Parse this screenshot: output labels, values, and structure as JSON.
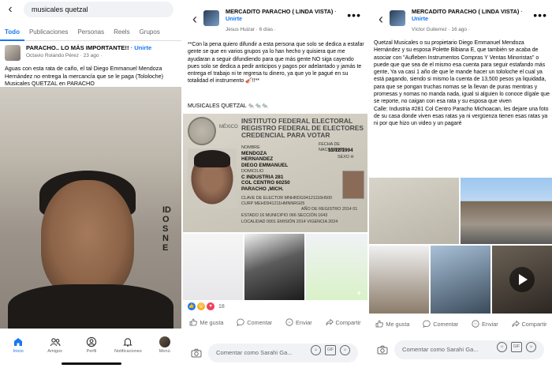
{
  "panel1": {
    "search": {
      "query": "musicales quetzal"
    },
    "tabs": [
      "Todo",
      "Publicaciones",
      "Personas",
      "Reels",
      "Grupos"
    ],
    "post": {
      "title": "PARACHO.. LO MÁS IMPORTANTE!!",
      "join": "· Unirte",
      "author": "Octavio Rolando Pérez · 23 ago ·",
      "text": "Aguas con esta rata de caño, el tal Diego Emmanuel Mendoza Hernández no entrega la mercancía que se le paga (Tololoche) Musicales QUETZAL en PARACHO"
    },
    "nav": [
      "Inicio",
      "Amigos",
      "Perfil",
      "Notificaciones",
      "Menú"
    ],
    "id_side_text": "ID\nO\nS\nN\nE"
  },
  "panel2": {
    "group": {
      "name": "MERCADITO PARACHO ( LINDA VISTA)",
      "join": "· Unirte"
    },
    "meta": "Jesus Huizar · 6 días ·",
    "text": "**Con la pena quiero difundir a esta persona que solo se dedica a estafar gente se que en varios grupos ya lo han hecho y quisiera que me ayudaran a seguir difundiendo para que más gente NO siga cayendo pues solo se dedica a pedir anticipos y pagos por adelantado y jamás te entrega el trabajo ni te regresa tu dinero, ya que yo le pagué en su totalidad el instrumento 🎻!!**",
    "tag": "MUSICALES QUETZAL 🐀🐀🐀",
    "idcard": {
      "h1": "INSTITUTO FEDERAL ELECTORAL",
      "h2": "REGISTRO FEDERAL DE ELECTORES",
      "h3": "CREDENCIAL PARA VOTAR",
      "country": "MÉXICO",
      "nombre_lbl": "NOMBRE",
      "nombre": "MENDOZA\nHERNANDEZ\nDIEGO EMMANUEL",
      "domicilio_lbl": "DOMICILIO",
      "domicilio": "C INDUSTRIA 281\nCOL CENTRO 60250\nPARACHO ,MICH.",
      "fecha_lbl": "FECHA DE NACIMIENTO",
      "fecha": "11/12/1994",
      "sexo_lbl": "SEXO H",
      "clave": "CLAVE DE ELECTOR MNHRDG94121116H500",
      "curp": "CURP MEHD941211HMNNRG05",
      "registro": "AÑO DE REGISTRO 2014  01",
      "estado": "ESTADO 16   MUNICIPIO 066   SECCIÓN 1643",
      "localidad": "LOCALIDAD 0001   EMISIÓN 2014   VIGENCIA 2024"
    },
    "thumbs_more": "+",
    "reactions": {
      "count": "18"
    },
    "actions": [
      "Me gusta",
      "Comentar",
      "Enviar",
      "Compartir"
    ],
    "comment_placeholder": "Comentar como Sarahi Ga..."
  },
  "panel3": {
    "group": {
      "name": "MERCADITO PARACHO ( LINDA VISTA)",
      "join": "· Unirte"
    },
    "meta": "Víctor Gutierrez · 16 ago ·",
    "text": "Quetzal Musicales o su propietario Diego Emmanuel Mendoza Hernández y su esposa Polette Bibiana E, que también se acaba de asociar con \"Aufleben Instrumentos Compras Y Ventas Minoristas\" o puede que que sea de el mismo esa cuenta para seguir estafando más gente, Ya va casi 1 año de que le mande hacer un tololoche el cual ya está pagando, siendo si mismo la cuenta de 13,500 pesos ya liquidada, para que se pongan truchas nomas se la llevan de puras mentiras y promesas y nomas no manda nada, igual si alguien lo conoce dígale que se reporte, no caigan con esa rata y su esposa que viven\nCalle: Industria #281 Col Centro Paracho Michoacan, les dejare una foto de su casa donde viven esas ratas ya ni vergüenza tienen esas ratas ya ni por que hizo un video y un pagaré",
    "actions": [
      "Me gusta",
      "Comentar",
      "Enviar",
      "Compartir"
    ],
    "comment_placeholder": "Comentar como Sarahi Ga..."
  },
  "colors": {
    "accent": "#1877f2",
    "muted": "#65676b",
    "bg_field": "#f0f2f5"
  }
}
